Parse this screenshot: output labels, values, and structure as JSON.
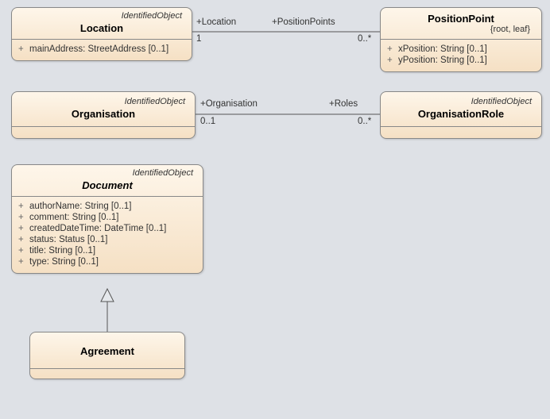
{
  "classes": {
    "location": {
      "stereotype": "IdentifiedObject",
      "name": "Location",
      "attrs": [
        {
          "vis": "+",
          "text": "mainAddress: StreetAddress [0..1]"
        }
      ]
    },
    "positionPoint": {
      "name": "PositionPoint",
      "constraint": "{root, leaf}",
      "attrs": [
        {
          "vis": "+",
          "text": "xPosition: String [0..1]"
        },
        {
          "vis": "+",
          "text": "yPosition: String [0..1]"
        }
      ]
    },
    "organisation": {
      "stereotype": "IdentifiedObject",
      "name": "Organisation"
    },
    "organisationRole": {
      "stereotype": "IdentifiedObject",
      "name": "OrganisationRole"
    },
    "document": {
      "stereotype": "IdentifiedObject",
      "name": "Document",
      "attrs": [
        {
          "vis": "+",
          "text": "authorName: String [0..1]"
        },
        {
          "vis": "+",
          "text": "comment: String [0..1]"
        },
        {
          "vis": "+",
          "text": "createdDateTime: DateTime [0..1]"
        },
        {
          "vis": "+",
          "text": "status: Status [0..1]"
        },
        {
          "vis": "+",
          "text": "title: String [0..1]"
        },
        {
          "vis": "+",
          "text": "type: String [0..1]"
        }
      ]
    },
    "agreement": {
      "name": "Agreement"
    }
  },
  "assoc": {
    "locPos": {
      "leftRole": "+Location",
      "leftMult": "1",
      "rightRole": "+PositionPoints",
      "rightMult": "0..*"
    },
    "orgRole": {
      "leftRole": "+Organisation",
      "leftMult": "0..1",
      "rightRole": "+Roles",
      "rightMult": "0..*"
    }
  }
}
